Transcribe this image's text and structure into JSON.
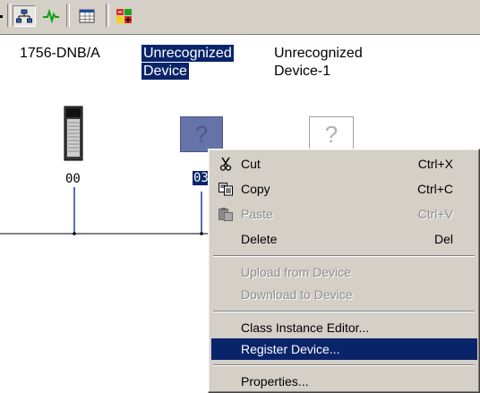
{
  "toolbar": {
    "buttons": [
      {
        "name": "network-view-icon",
        "pressed": true
      },
      {
        "name": "graph-icon",
        "pressed": false
      },
      {
        "name": "spreadsheet-icon",
        "pressed": false
      },
      {
        "name": "edit-io-icon",
        "pressed": false
      }
    ]
  },
  "devices": {
    "scanner_label": "1756-DNB/A",
    "selected_label_line1": "Unrecognized",
    "selected_label_line2": "Device",
    "device1_label_line1": "Unrecognized",
    "device1_label_line2": "Device-1",
    "scanner_address": "00",
    "selected_address": "03",
    "unknown_glyph": "?"
  },
  "context_menu": {
    "items": [
      {
        "label": "Cut",
        "shortcut": "Ctrl+X",
        "enabled": true,
        "icon": "scissors-icon"
      },
      {
        "label": "Copy",
        "shortcut": "Ctrl+C",
        "enabled": true,
        "icon": "copy-icon"
      },
      {
        "label": "Paste",
        "shortcut": "Ctrl+V",
        "enabled": false,
        "icon": "paste-icon"
      },
      {
        "label": "Delete",
        "shortcut": "Del",
        "enabled": true
      },
      {
        "label": "Upload from Device",
        "enabled": false
      },
      {
        "label": "Download to Device",
        "enabled": false
      },
      {
        "label": "Class Instance Editor...",
        "enabled": true
      },
      {
        "label": "Register Device...",
        "enabled": true,
        "highlighted": true
      },
      {
        "label": "Properties...",
        "enabled": true
      }
    ]
  },
  "colors": {
    "selection": "#0a246a",
    "menu_bg": "#d4d0c8",
    "bus_line": "#1f3f9f",
    "disabled_text": "#8c8c8c"
  }
}
